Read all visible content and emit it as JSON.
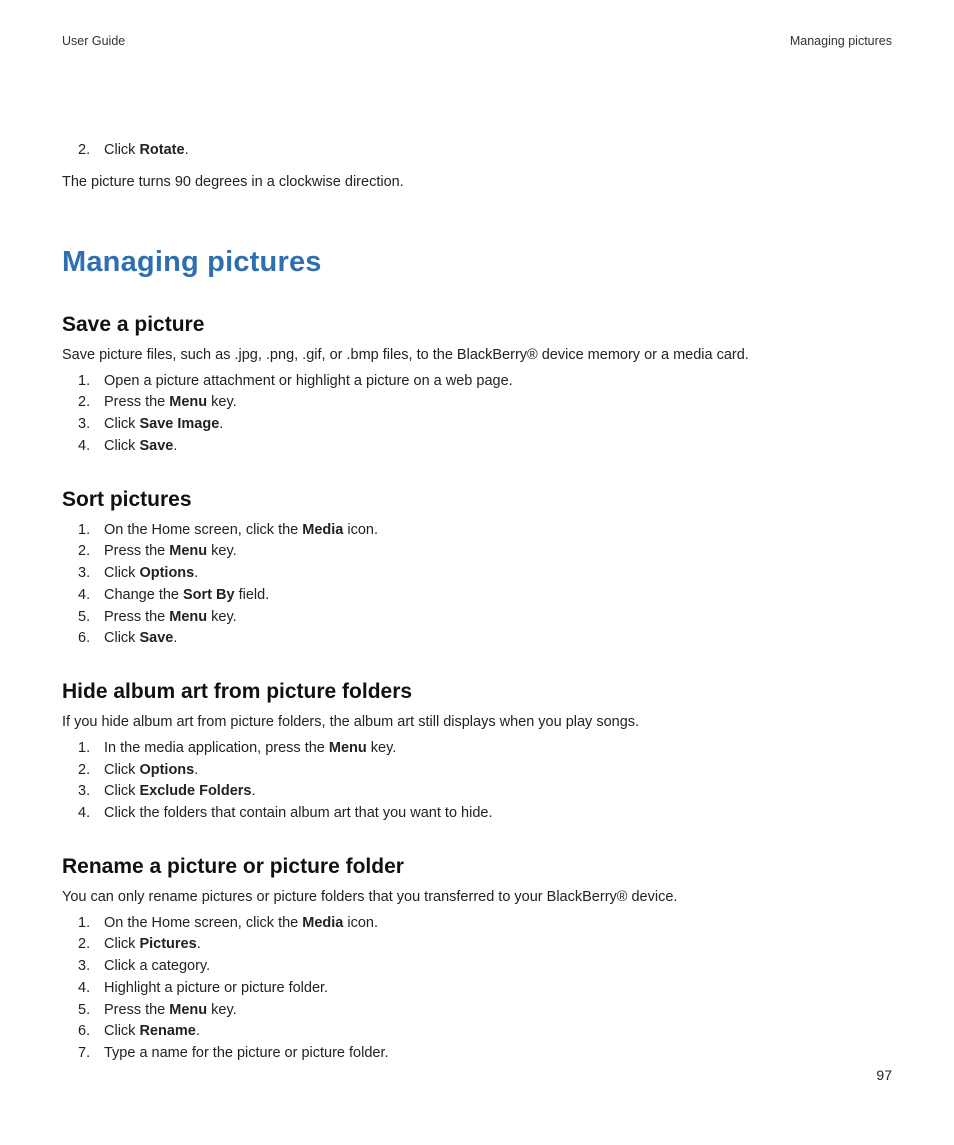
{
  "header": {
    "left": "User Guide",
    "right": "Managing pictures"
  },
  "intro": {
    "step_num": "2.",
    "step_parts": [
      "Click ",
      "Rotate",
      "."
    ],
    "note": "The picture turns 90 degrees in a clockwise direction."
  },
  "section_title": "Managing pictures",
  "blocks": [
    {
      "heading": "Save a picture",
      "desc": "Save picture files, such as .jpg, .png, .gif, or .bmp files, to the BlackBerry® device memory or a media card.",
      "steps": [
        [
          {
            "t": "Open a picture attachment or highlight a picture on a web page."
          }
        ],
        [
          {
            "t": "Press the "
          },
          {
            "b": "Menu"
          },
          {
            "t": " key."
          }
        ],
        [
          {
            "t": "Click "
          },
          {
            "b": "Save Image"
          },
          {
            "t": "."
          }
        ],
        [
          {
            "t": "Click "
          },
          {
            "b": "Save"
          },
          {
            "t": "."
          }
        ]
      ]
    },
    {
      "heading": "Sort pictures",
      "steps": [
        [
          {
            "t": "On the Home screen, click the "
          },
          {
            "b": "Media"
          },
          {
            "t": " icon."
          }
        ],
        [
          {
            "t": "Press the "
          },
          {
            "b": "Menu"
          },
          {
            "t": " key."
          }
        ],
        [
          {
            "t": "Click "
          },
          {
            "b": "Options"
          },
          {
            "t": "."
          }
        ],
        [
          {
            "t": "Change the "
          },
          {
            "b": "Sort By"
          },
          {
            "t": " field."
          }
        ],
        [
          {
            "t": "Press the "
          },
          {
            "b": "Menu"
          },
          {
            "t": " key."
          }
        ],
        [
          {
            "t": "Click "
          },
          {
            "b": "Save"
          },
          {
            "t": "."
          }
        ]
      ]
    },
    {
      "heading": "Hide album art from picture folders",
      "desc": "If you hide album art from picture folders, the album art still displays when you play songs.",
      "steps": [
        [
          {
            "t": "In the media application, press the "
          },
          {
            "b": "Menu"
          },
          {
            "t": " key."
          }
        ],
        [
          {
            "t": "Click "
          },
          {
            "b": "Options"
          },
          {
            "t": "."
          }
        ],
        [
          {
            "t": "Click "
          },
          {
            "b": "Exclude Folders"
          },
          {
            "t": "."
          }
        ],
        [
          {
            "t": "Click the folders that contain album art that you want to hide."
          }
        ]
      ]
    },
    {
      "heading": "Rename a picture or picture folder",
      "desc": "You can only rename pictures or picture folders that you transferred to your BlackBerry® device.",
      "steps": [
        [
          {
            "t": "On the Home screen, click the "
          },
          {
            "b": "Media"
          },
          {
            "t": " icon."
          }
        ],
        [
          {
            "t": "Click "
          },
          {
            "b": "Pictures"
          },
          {
            "t": "."
          }
        ],
        [
          {
            "t": "Click a category."
          }
        ],
        [
          {
            "t": "Highlight a picture or picture folder."
          }
        ],
        [
          {
            "t": "Press the "
          },
          {
            "b": "Menu"
          },
          {
            "t": " key."
          }
        ],
        [
          {
            "t": "Click "
          },
          {
            "b": "Rename"
          },
          {
            "t": "."
          }
        ],
        [
          {
            "t": "Type a name for the picture or picture folder."
          }
        ]
      ]
    }
  ],
  "page_number": "97"
}
